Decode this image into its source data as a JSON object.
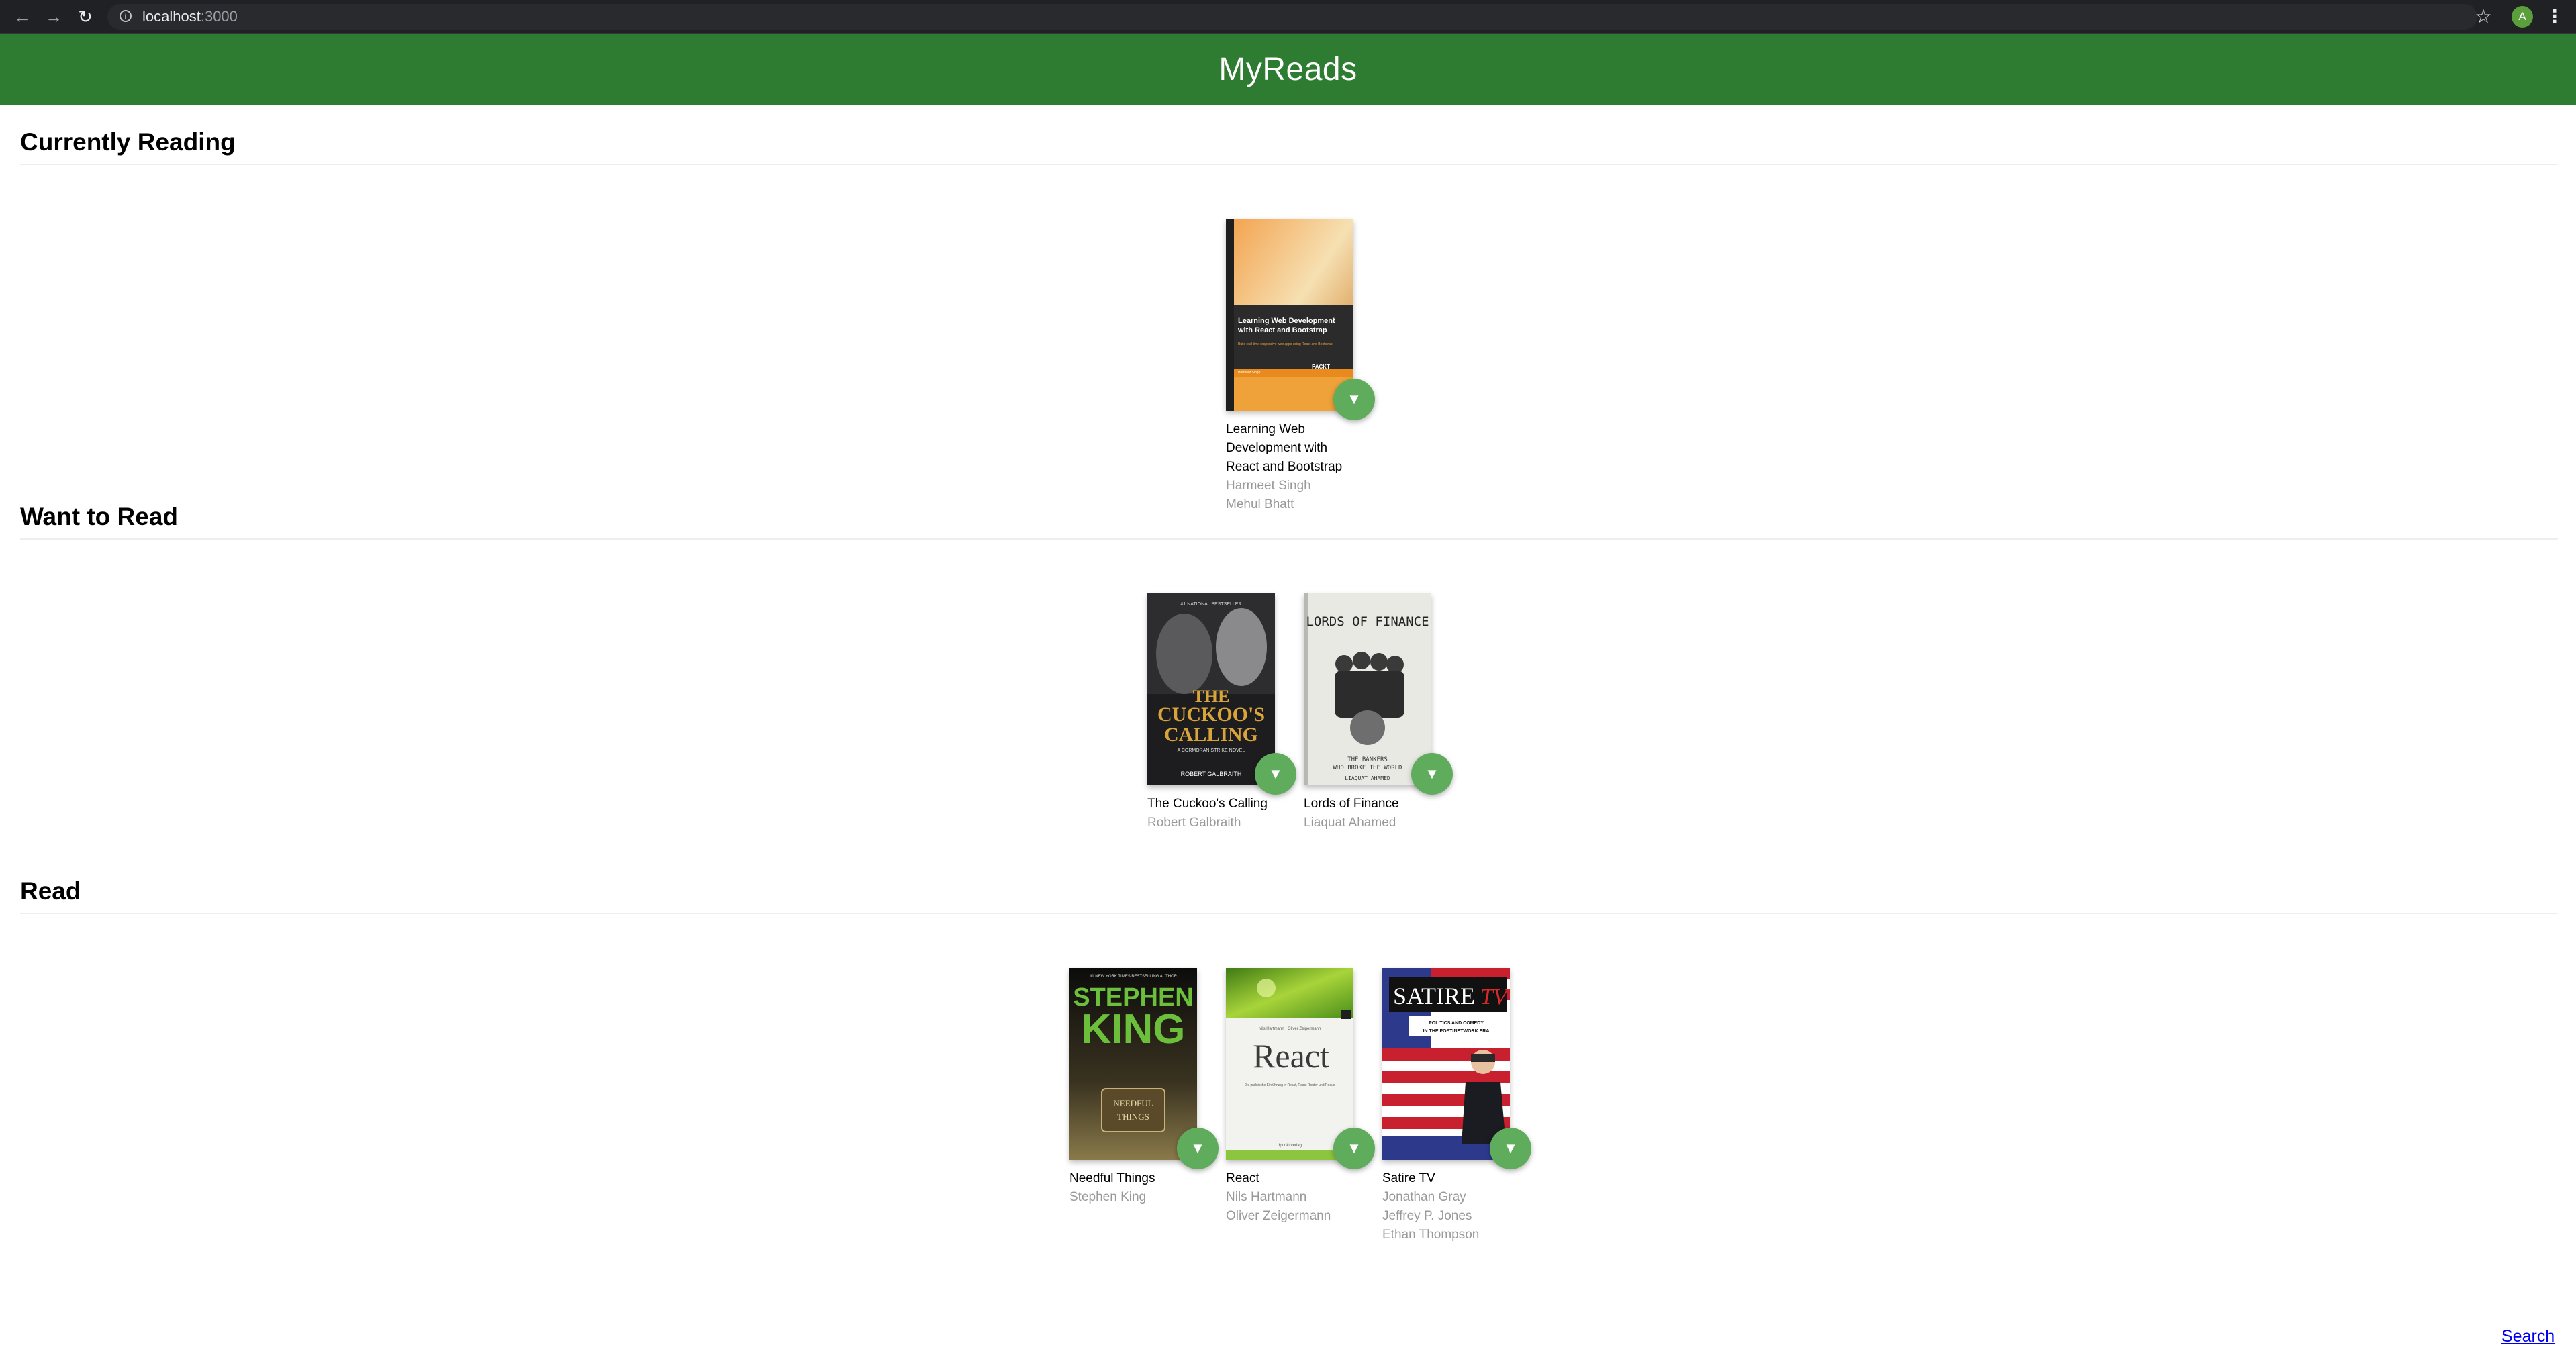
{
  "browser": {
    "url_host": "localhost",
    "url_port": ":3000",
    "profile_initial": "A",
    "icons": [
      "back-arrow-icon",
      "forward-arrow-icon",
      "reload-icon",
      "info-icon",
      "bookmark-star-icon",
      "kebab-menu-icon"
    ]
  },
  "app": {
    "title": "MyReads",
    "header_color": "#2e7c31",
    "changer_color": "#60ac5d"
  },
  "shelves": [
    {
      "title": "Currently Reading",
      "books": [
        {
          "title_lines": [
            "Learning Web",
            "Development with",
            "React and Bootstrap"
          ],
          "authors": [
            "Harmeet Singh",
            "Mehul Bhatt"
          ],
          "cover_text": [
            "Learning Web Development",
            "with React and Bootstrap",
            "Build real-time responsive web apps using React and Bootstrap",
            "Harmeet Singh",
            "Mehul Bhatt",
            "PACKT"
          ]
        }
      ]
    },
    {
      "title": "Want to Read",
      "books": [
        {
          "title": "The Cuckoo's Calling",
          "authors": [
            "Robert Galbraith"
          ],
          "cover_text": [
            "#1 NATIONAL BESTSELLER",
            "THE",
            "CUCKOO'S",
            "CALLING",
            "A CORMORAN STRIKE NOVEL",
            "ROBERT GALBRAITH"
          ]
        },
        {
          "title": "Lords of Finance",
          "authors": [
            "Liaquat Ahamed"
          ],
          "cover_text": [
            "LORDS OF FINANCE",
            "THE BANKERS",
            "WHO BROKE THE WORLD",
            "LIAQUAT AHAMED"
          ]
        }
      ]
    },
    {
      "title": "Read",
      "books": [
        {
          "title": "Needful Things",
          "authors": [
            "Stephen King"
          ],
          "cover_text": [
            "#1 NEW YORK TIMES BESTSELLING AUTHOR",
            "STEPHEN",
            "KING",
            "NEEDFUL",
            "THINGS"
          ]
        },
        {
          "title": "React",
          "authors": [
            "Nils Hartmann",
            "Oliver Zeigermann"
          ],
          "cover_text": [
            "Nils Hartmann · Oliver Zeigermann",
            "React",
            "Die praktische Einführung in React, React Router und Redux",
            "dpunkt.verlag"
          ]
        },
        {
          "title": "Satire TV",
          "authors": [
            "Jonathan Gray",
            "Jeffrey P. Jones",
            "Ethan Thompson"
          ],
          "cover_text": [
            "SATIRE",
            "TV",
            "POLITICS AND COMEDY",
            "IN THE POST-NETWORK ERA"
          ]
        }
      ]
    }
  ],
  "footer": {
    "search_label": "Search"
  }
}
